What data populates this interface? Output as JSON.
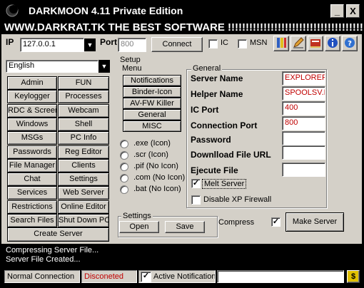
{
  "window": {
    "title": "DARKMOON 4.11 Private Edition",
    "minimize_glyph": "_",
    "close_glyph": "X",
    "banner": "WWW.DARKRAT.TK THE BEST SOFTWARE !!!!!!!!!!!!!!!!!!!!!!!!!!!!!!!!!!!!!!!!!!!!!!!!!!!!!!"
  },
  "connection": {
    "ip_label": "IP",
    "ip_value": "127.0.0.1",
    "port_label": "Port",
    "port_value": "800",
    "connect_label": "Connect",
    "ic_label": "IC",
    "msn_label": "MSN"
  },
  "toolbar_icons": [
    "paint-icon",
    "pencil-icon",
    "book-icon",
    "info-icon",
    "help-icon"
  ],
  "language": {
    "selected": "English"
  },
  "nav": {
    "rows": [
      [
        "Admin",
        "FUN"
      ],
      [
        "Keylogger",
        "Processes"
      ],
      [
        "RDC & Screen",
        "Webcam"
      ],
      [
        "Windows",
        "Shell"
      ],
      [
        "MSGs",
        "PC Info"
      ],
      [
        "Passwords",
        "Reg Editor"
      ],
      [
        "File Manager",
        "Clients"
      ],
      [
        "Chat",
        "Settings"
      ],
      [
        "Services",
        "Web Server"
      ],
      [
        "Restrictions",
        "Online Editor"
      ],
      [
        "Search Files",
        "Shut Down PC"
      ]
    ],
    "create_server": "Create Server"
  },
  "setup_menu": {
    "title_line1": "Setup",
    "title_line2": "Menu",
    "items": [
      "Notifications",
      "Binder-Icon",
      "AV-FW Killer",
      "General",
      "MISC"
    ]
  },
  "extensions": [
    ".exe (Icon)",
    ".scr (Icon)",
    ".pif (No Icon)",
    ".com (No Icon)",
    ".bat (No Icon)"
  ],
  "settings_group": {
    "title": "Settings",
    "open": "Open",
    "save": "Save"
  },
  "general": {
    "title": "General",
    "fields": [
      {
        "label": "Server Name",
        "value": "EXPLORER.EXE"
      },
      {
        "label": "Helper Name",
        "value": "SPOOLSV.EXE"
      },
      {
        "label": "IC Port",
        "value": "400"
      },
      {
        "label": "Connection Port",
        "value": "800"
      },
      {
        "label": "Password",
        "value": ""
      },
      {
        "label": "Downlload File URL",
        "value": ""
      },
      {
        "label": "Ejecute File",
        "value": ""
      }
    ],
    "melt_server": "Melt Server",
    "disable_firewall": "Disable XP Firewall"
  },
  "compress": {
    "label": "Compress",
    "make_server": "Make Server"
  },
  "log": {
    "lines": [
      "Compressing Server File...",
      "Server File Created..."
    ]
  },
  "status": {
    "connection": "Normal Connection",
    "state": "Disconeted",
    "active_notification": "Active Notification",
    "dollar": "$"
  },
  "colors": {
    "red_text": "#c00000",
    "chrome": "#d4d0c8"
  }
}
